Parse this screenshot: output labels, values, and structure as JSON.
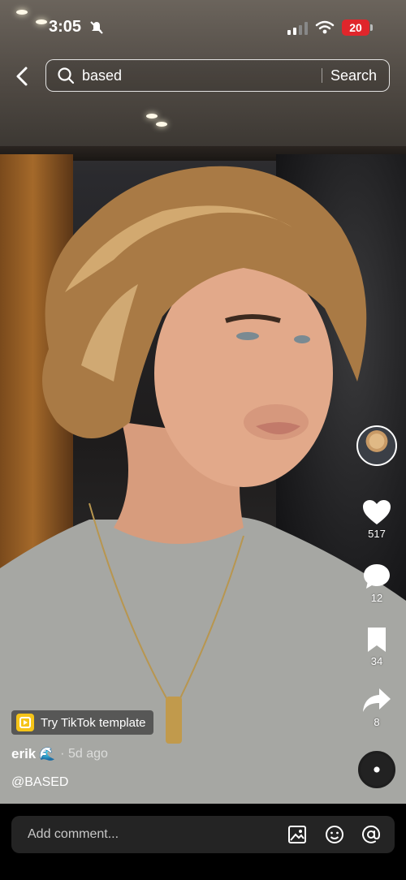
{
  "status_bar": {
    "time": "3:05",
    "battery": "20"
  },
  "search": {
    "value": "based",
    "button_label": "Search"
  },
  "actions": {
    "likes": "517",
    "comments": "12",
    "saves": "34",
    "shares": "8"
  },
  "template": {
    "label": "Try TikTok template"
  },
  "post": {
    "author": "erik",
    "author_emoji": "🌊",
    "time_ago": "· 5d ago",
    "caption": "@BASED"
  },
  "comment": {
    "placeholder": "Add comment..."
  },
  "colors": {
    "battery_red": "#e0262b",
    "template_yellow": "#f5c418"
  }
}
